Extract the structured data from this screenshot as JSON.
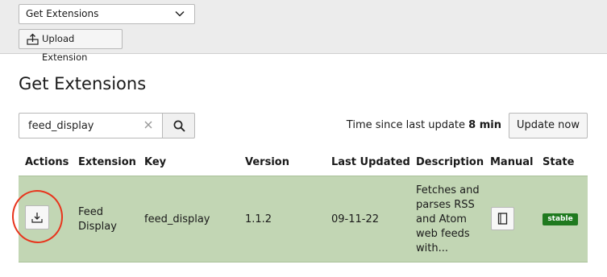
{
  "toolbar": {
    "dropdown_value": "Get Extensions",
    "upload_label": "Upload Extension"
  },
  "page": {
    "title": "Get Extensions"
  },
  "search": {
    "value": "feed_display"
  },
  "update": {
    "since_prefix": "Time since last update",
    "since_value": "8 min",
    "button_label": "Update now"
  },
  "table": {
    "headers": [
      "Actions",
      "Extension",
      "Key",
      "Version",
      "Last Updated",
      "Description",
      "Manual",
      "State"
    ],
    "row": {
      "extension": "Feed Display",
      "key": "feed_display",
      "version": "1.1.2",
      "last_updated": "09-11-22",
      "description": "Fetches and parses RSS and Atom web feeds with...",
      "state": "stable"
    }
  },
  "colors": {
    "row_highlight": "#c2d6b4",
    "state_badge": "#1f7a1f",
    "annotation_circle": "#e8341c"
  }
}
